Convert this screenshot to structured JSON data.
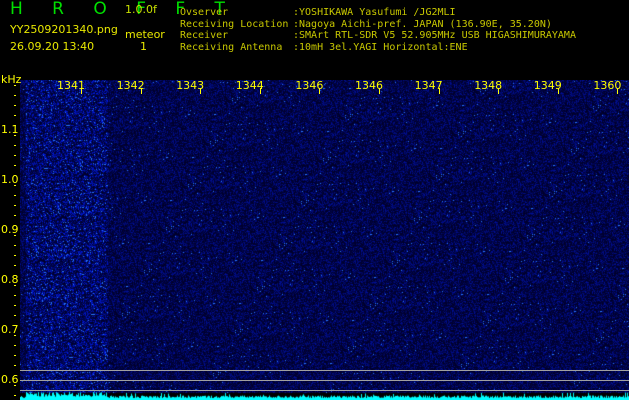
{
  "header": {
    "title": "H R O F F T",
    "version": "1.0.0f",
    "filename": "YY2509201340.png",
    "datetime": "26.09.20 13:40",
    "meteor_label": "meteor",
    "meteor_count": "1"
  },
  "info": {
    "labels": [
      "Ovserver",
      "Receiving Location",
      "Receiver",
      "Receiving Antenna"
    ],
    "values": [
      ":YOSHIKAWA Yasufumi /JG2MLI",
      ":Nagoya Aichi-pref. JAPAN (136.90E, 35.20N)",
      ":SMArt RTL-SDR V5 52.905MHz USB HIGASHIMURAYAMA",
      ":10mH 3el.YAGI Horizontal:ENE"
    ]
  },
  "axis": {
    "unit": "kHz",
    "x_ticks": [
      "1341",
      "1342",
      "1343",
      "1344",
      "1346",
      "1346",
      "1347",
      "1348",
      "1349",
      "1360"
    ],
    "y_ticks": [
      "1.1",
      "1.0",
      "0.9",
      "0.8",
      "0.7",
      "0.6"
    ]
  },
  "colors": {
    "background": "#000000",
    "spectrum": "#1a1aff",
    "level": "#00ffff",
    "axis": "#ffff00"
  }
}
